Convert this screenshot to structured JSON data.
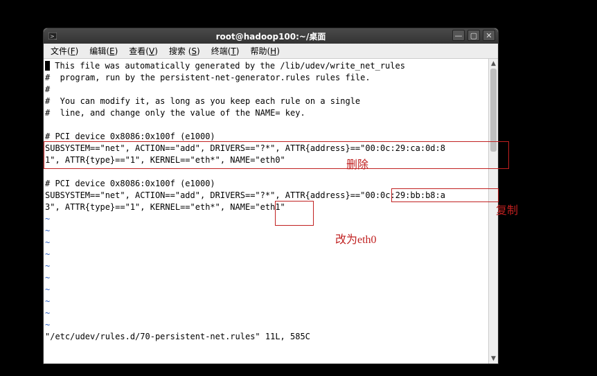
{
  "titlebar": {
    "title": "root@hadoop100:~/桌面"
  },
  "menubar": {
    "items": [
      {
        "label": "文件",
        "accel": "F"
      },
      {
        "label": "编辑",
        "accel": "E"
      },
      {
        "label": "查看",
        "accel": "V"
      },
      {
        "label": "搜索",
        "accel": "S"
      },
      {
        "label": "终端",
        "accel": "T"
      },
      {
        "label": "帮助",
        "accel": "H"
      }
    ]
  },
  "terminal": {
    "lines": [
      "# This file was automatically generated by the /lib/udev/write_net_rules",
      "#  program, run by the persistent-net-generator.rules rules file.",
      "#",
      "#  You can modify it, as long as you keep each rule on a single",
      "#  line, and change only the value of the NAME= key.",
      "",
      "# PCI device 0x8086:0x100f (e1000)",
      "SUBSYSTEM==\"net\", ACTION==\"add\", DRIVERS==\"?*\", ATTR{address}==\"00:0c:29:ca:0d:8",
      "1\", ATTR{type}==\"1\", KERNEL==\"eth*\", NAME=\"eth0\"",
      "",
      "# PCI device 0x8086:0x100f (e1000)",
      "SUBSYSTEM==\"net\", ACTION==\"add\", DRIVERS==\"?*\", ATTR{address}==\"00:0c:29:bb:b8:a",
      "3\", ATTR{type}==\"1\", KERNEL==\"eth*\", NAME=\"eth1\""
    ],
    "tilde_count": 10,
    "status_line": "\"/etc/udev/rules.d/70-persistent-net.rules\" 11L, 585C"
  },
  "annotations": {
    "delete_label": "删除",
    "copy_label": "复制",
    "change_label": "改为eth0"
  }
}
